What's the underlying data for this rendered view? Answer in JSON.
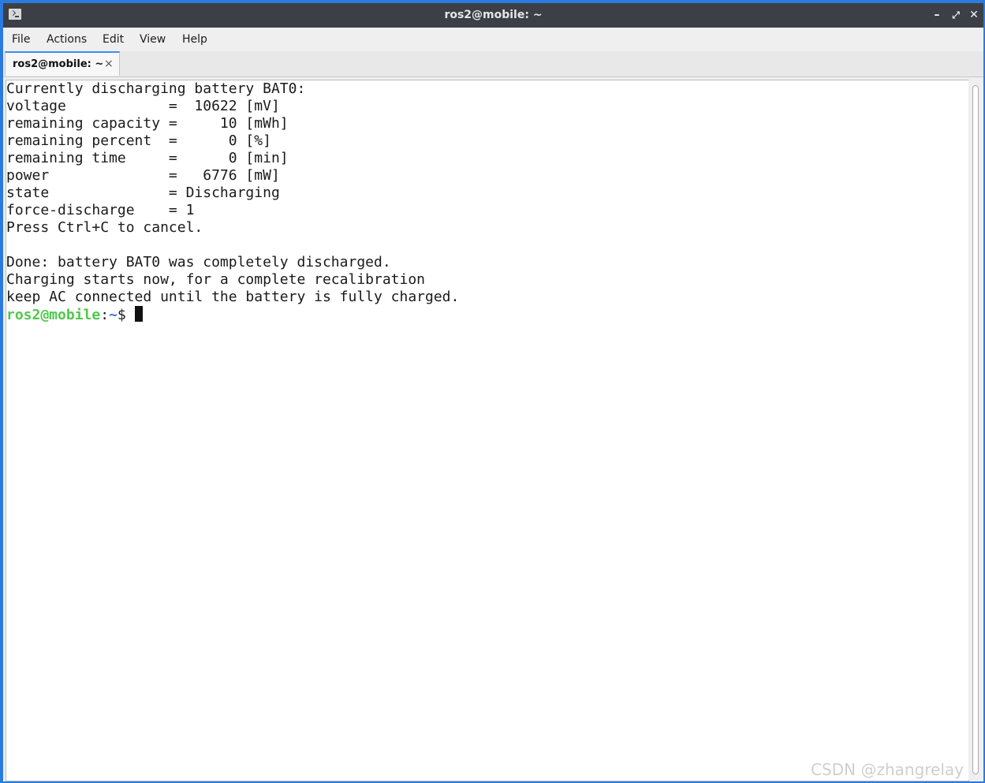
{
  "window": {
    "title": "ros2@mobile: ~",
    "icons": {
      "app": "terminal-icon",
      "minimize": "minimize-icon",
      "maximize": "maximize-icon",
      "close": "close-icon"
    },
    "minimize_glyph": "–",
    "maximize_glyph": "⤢",
    "close_glyph": "✕"
  },
  "menubar": {
    "items": [
      "File",
      "Actions",
      "Edit",
      "View",
      "Help"
    ]
  },
  "tabs": [
    {
      "label": "ros2@mobile: ~",
      "close_glyph": "×",
      "active": true
    }
  ],
  "terminal": {
    "lines": [
      "Currently discharging battery BAT0:",
      "voltage            =  10622 [mV]",
      "remaining capacity =     10 [mWh]",
      "remaining percent  =      0 [%]",
      "remaining time     =      0 [min]",
      "power              =   6776 [mW]",
      "state              = Discharging",
      "force-discharge    = 1",
      "Press Ctrl+C to cancel.",
      "",
      "Done: battery BAT0 was completely discharged.",
      "Charging starts now, for a complete recalibration",
      "keep AC connected until the battery is fully charged."
    ],
    "prompt": {
      "user_host": "ros2@mobile",
      "colon": ":",
      "dir": "~",
      "symbol": "$ "
    },
    "colors": {
      "prompt_user": "#4ec94a",
      "prompt_dir": "#4a6fdd",
      "text": "#1a1a1a",
      "background": "#ffffff"
    }
  },
  "watermark": "CSDN @zhangrelay"
}
